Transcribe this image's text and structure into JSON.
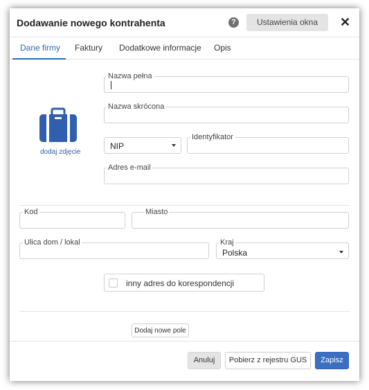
{
  "dialog": {
    "title": "Dodawanie nowego kontrahenta",
    "help_glyph": "?",
    "settings_label": "Ustawienia okna",
    "close_glyph": "✕"
  },
  "tabs": [
    {
      "label": "Dane firmy",
      "active": true
    },
    {
      "label": "Faktury",
      "active": false
    },
    {
      "label": "Dodatkowe informacje",
      "active": false
    },
    {
      "label": "Opis",
      "active": false
    }
  ],
  "company": {
    "full_name_label": "Nazwa pełna",
    "full_name_value": "",
    "short_name_label": "Nazwa skrócona",
    "short_name_value": "",
    "id_type_value": "NIP",
    "identifier_label": "Identyfikator",
    "identifier_value": "",
    "email_label": "Adres e-mail",
    "email_value": "",
    "photo_icon": "briefcase-icon",
    "photo_link": "dodaj zdjęcie"
  },
  "address": {
    "postal_code_label": "Kod",
    "city_label": "Miasto",
    "street_label": "Ulica dom / lokal",
    "country_label": "Kraj",
    "country_value": "Polska"
  },
  "correspondence": {
    "checkbox_label": "inny adres do korespondencji",
    "checked": false
  },
  "add_field_label": "Dodaj nowe pole",
  "footer": {
    "cancel_label": "Anuluj",
    "gus_label": "Pobierz z rejestru GUS",
    "save_label": "Zapisz"
  },
  "colors": {
    "accent": "#2b6cb0",
    "save_button": "#3a6fc2",
    "photo_icon": "#2f5fae"
  }
}
